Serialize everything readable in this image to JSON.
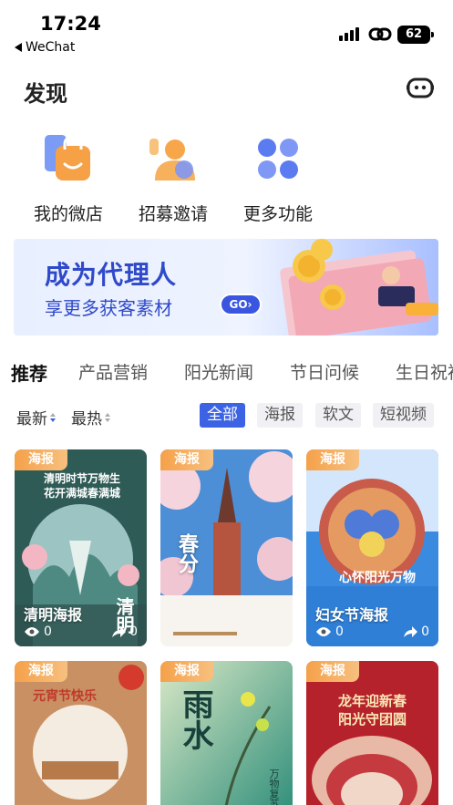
{
  "status_bar": {
    "time": "17:24",
    "back_app": "WeChat",
    "battery": "62"
  },
  "header": {
    "title": "发现"
  },
  "quick_actions": [
    {
      "label": "我的微店",
      "icon": "shopping-bag-icon"
    },
    {
      "label": "招募邀请",
      "icon": "recruit-user-icon"
    },
    {
      "label": "更多功能",
      "icon": "more-grid-icon"
    }
  ],
  "banner": {
    "title": "成为代理人",
    "subtitle": "享更多获客素材",
    "go_label": "GO"
  },
  "tabs": [
    "推荐",
    "产品营销",
    "阳光新闻",
    "节日问候",
    "生日祝福"
  ],
  "sort": {
    "latest": "最新",
    "hottest": "最热"
  },
  "filters": [
    "全部",
    "海报",
    "软文",
    "短视频"
  ],
  "cards": [
    {
      "tag": "海报",
      "title_lines": [
        "清明时节万物生",
        "花开满城春满城"
      ],
      "name": "清明海报",
      "big": "清明",
      "views": "0",
      "shares": "0"
    },
    {
      "tag": "海报",
      "title_lines": [
        "春分"
      ],
      "name": "",
      "views": "",
      "shares": ""
    },
    {
      "tag": "海报",
      "title_lines": [
        "心怀阳光万物",
        "妇女节"
      ],
      "name": "妇女节海报",
      "views": "0",
      "shares": "0"
    },
    {
      "tag": "海报",
      "title_lines": [
        "元宵节快乐"
      ],
      "name": ""
    },
    {
      "tag": "海报",
      "title_lines": [
        "雨水",
        "万物复苏"
      ],
      "name": ""
    },
    {
      "tag": "海报",
      "title_lines": [
        "龙年迎新春",
        "阳光守团圆"
      ],
      "name": ""
    }
  ],
  "colors": {
    "accent": "#3c63e3",
    "tag_orange": "#f5a14a",
    "banner_text": "#2f49c9"
  }
}
